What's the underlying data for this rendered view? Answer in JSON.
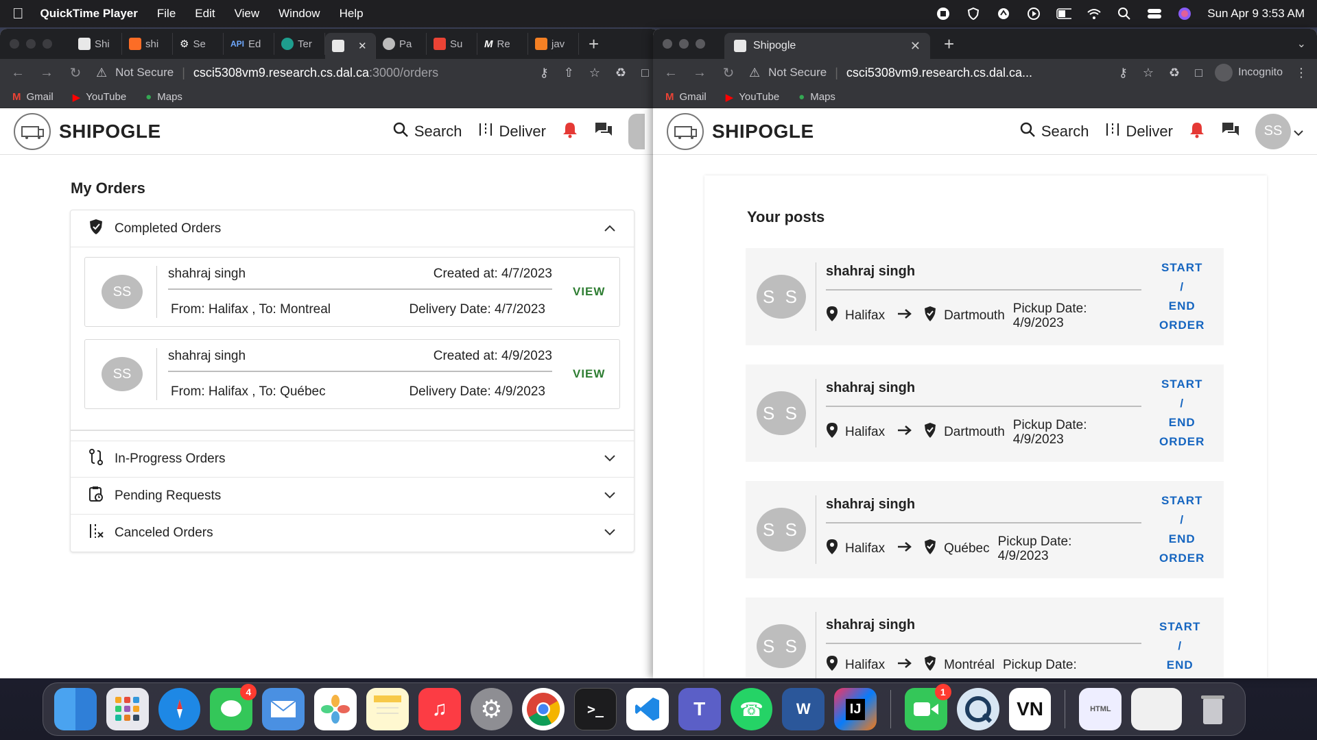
{
  "menubar": {
    "app_name": "QuickTime Player",
    "menus": [
      "File",
      "Edit",
      "View",
      "Window",
      "Help"
    ],
    "datetime": "Sun Apr 9  3:53 AM"
  },
  "left_window": {
    "tabs": [
      "Shi",
      "shi",
      "Se",
      "Ed",
      "Ter",
      "",
      "Pa",
      "Su",
      "Re",
      "jav"
    ],
    "tab_badge_api": "API",
    "security": "Not Secure",
    "url_host": "csci5308vm9.research.cs.dal.ca",
    "url_path": ":3000/orders"
  },
  "right_window": {
    "tab_title": "Shipogle",
    "security": "Not Secure",
    "url_host": "csci5308vm9.research.cs.dal.ca...",
    "incognito_label": "Incognito"
  },
  "bookmarks": [
    "Gmail",
    "YouTube",
    "Maps"
  ],
  "app": {
    "brand": "SHIPOGLE",
    "nav_search": "Search",
    "nav_deliver": "Deliver",
    "avatar_initials": "SS"
  },
  "orders": {
    "title": "My Orders",
    "sections": {
      "completed": "Completed Orders",
      "in_progress": "In-Progress Orders",
      "pending": "Pending Requests",
      "canceled": "Canceled Orders"
    },
    "completed_items": [
      {
        "initials": "SS",
        "name": "shahraj singh",
        "created": "Created at: 4/7/2023",
        "route": "From: Halifax , To: Montreal",
        "delivery": "Delivery Date: 4/7/2023",
        "action": "VIEW"
      },
      {
        "initials": "SS",
        "name": "shahraj singh",
        "created": "Created at: 4/9/2023",
        "route": "From: Halifax , To: Québec",
        "delivery": "Delivery Date: 4/9/2023",
        "action": "VIEW"
      }
    ]
  },
  "posts": {
    "title": "Your posts",
    "items": [
      {
        "initials": "S S",
        "name": "shahraj singh",
        "from": "Halifax",
        "to": "Dartmouth",
        "pickup_label": "Pickup Date:",
        "pickup_date": "4/9/2023",
        "action": [
          "START",
          "/",
          "END",
          "ORDER"
        ]
      },
      {
        "initials": "S S",
        "name": "shahraj singh",
        "from": "Halifax",
        "to": "Dartmouth",
        "pickup_label": "Pickup Date:",
        "pickup_date": "4/9/2023",
        "action": [
          "START",
          "/",
          "END",
          "ORDER"
        ]
      },
      {
        "initials": "S S",
        "name": "shahraj singh",
        "from": "Halifax",
        "to": "Québec",
        "pickup_label": "Pickup Date:",
        "pickup_date": "4/9/2023",
        "action": [
          "START",
          "/",
          "END",
          "ORDER"
        ]
      },
      {
        "initials": "S S",
        "name": "shahraj singh",
        "from": "Halifax",
        "to": "Montréal",
        "pickup_label": "Pickup Date:",
        "pickup_date": "",
        "action": [
          "START",
          "/",
          "END",
          ""
        ]
      }
    ]
  },
  "dock": {
    "messages_badge": "4",
    "facetime_badge": "1",
    "word_label": "W",
    "intellij_label": "IJ",
    "vn_label": "VN",
    "terminal_label": ">_",
    "html_label": "HTML"
  },
  "colors": {
    "view_green": "#2e7d32",
    "action_blue": "#1565c0",
    "bell_red": "#e53935",
    "avatar_grey": "#bdbdbd"
  }
}
